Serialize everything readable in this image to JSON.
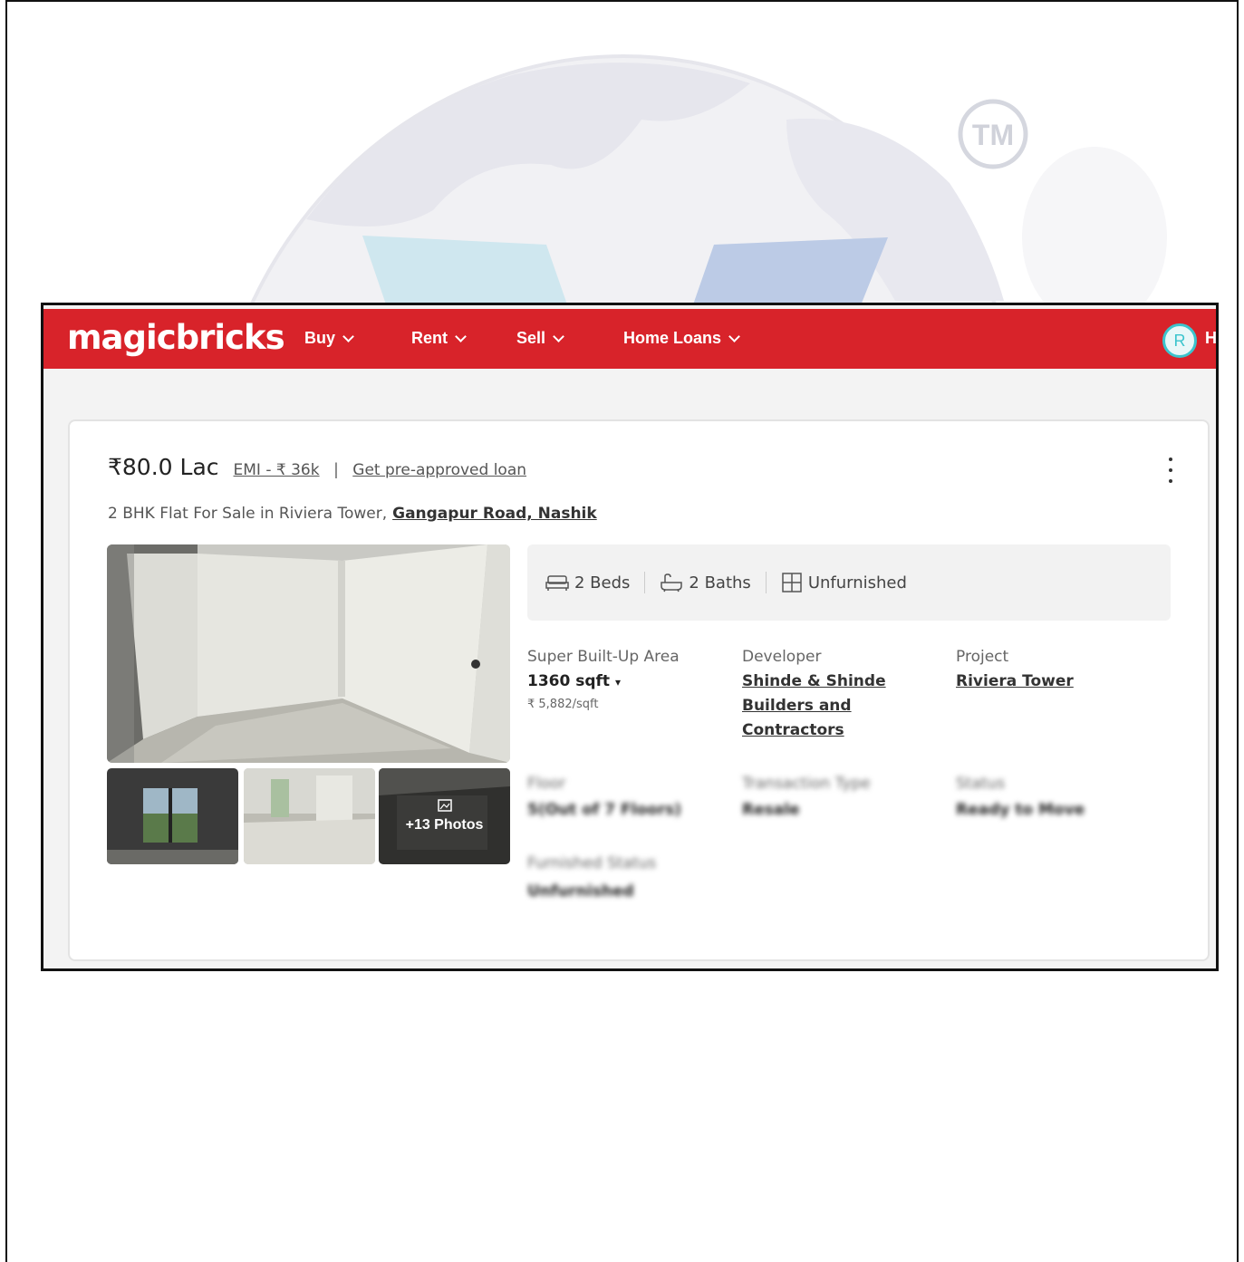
{
  "watermark": {
    "tm_text": "TM"
  },
  "header": {
    "logo": "magicbricks",
    "nav": [
      {
        "label": "Buy"
      },
      {
        "label": "Rent"
      },
      {
        "label": "Sell"
      },
      {
        "label": "Home Loans"
      }
    ],
    "avatar_initial": "R",
    "cut_text": "H"
  },
  "listing": {
    "price": "₹80.0 Lac",
    "emi": "EMI - ₹ 36k",
    "separator": "|",
    "loan_link": "Get pre-approved loan",
    "title": "2 BHK Flat For Sale in Riviera Tower,",
    "location": "Gangapur Road, Nashik",
    "more_photos": "+13 Photos",
    "summary": {
      "beds": "2 Beds",
      "baths": "2 Baths",
      "furnishing": "Unfurnished"
    },
    "details": {
      "area_label": "Super Built-Up Area",
      "area_value": "1360 sqft",
      "area_rate": "₹ 5,882/sqft",
      "developer_label": "Developer",
      "developer_value": [
        "Shinde & Shinde",
        "Builders and",
        "Contractors"
      ],
      "project_label": "Project",
      "project_value": "Riviera Tower",
      "floor_label": "Floor",
      "floor_value": "5(Out of 7 Floors)",
      "transaction_label": "Transaction Type",
      "transaction_value": "Resale",
      "status_label": "Status",
      "status_value": "Ready to Move",
      "furnished_label": "Furnished Status",
      "furnished_value": "Unfurnished"
    }
  },
  "colors": {
    "brand": "#d8232a",
    "accent": "#3bc4cd"
  }
}
